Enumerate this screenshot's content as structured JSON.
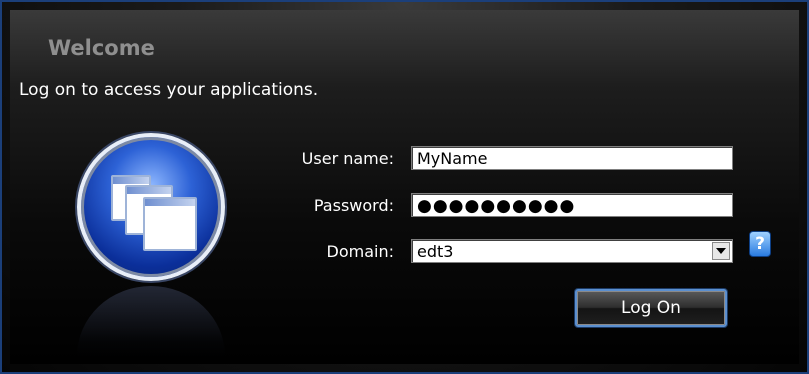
{
  "dialog": {
    "title": "Welcome",
    "subtitle": "Log on to access your applications."
  },
  "form": {
    "username_label": "User name:",
    "username_value": "MyName",
    "password_label": "Password:",
    "password_value": "●●●●●●●●●●",
    "domain_label": "Domain:",
    "domain_value": "edt3",
    "help_glyph": "?",
    "logon_label": "Log On"
  },
  "icons": {
    "logo": "applications-logo-icon",
    "help": "help-icon",
    "dropdown": "chevron-down-icon"
  },
  "colors": {
    "background": "#000000",
    "frame_border": "#1b3f7a",
    "logo_blue": "#2d62d6",
    "title_gray": "#8f8f8f",
    "button_border": "#5b8fcf"
  }
}
